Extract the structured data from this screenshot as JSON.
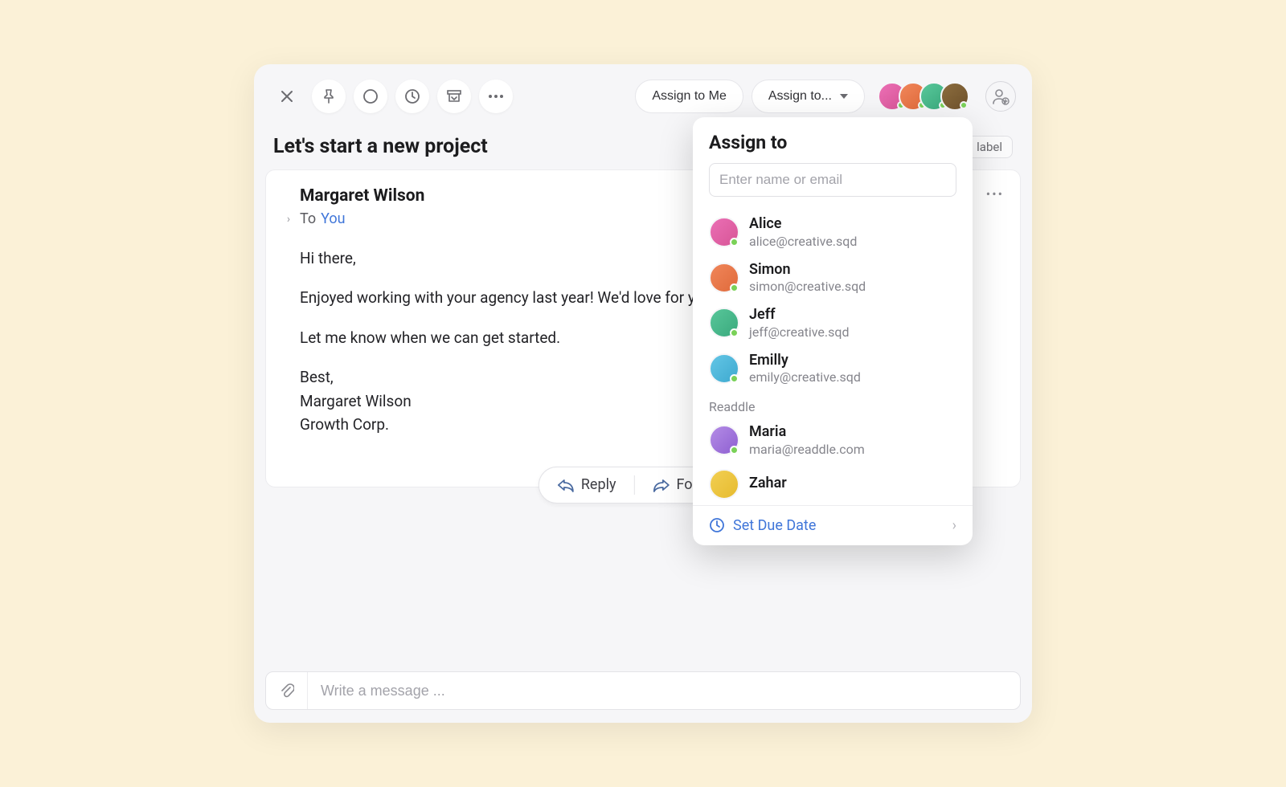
{
  "toolbar": {
    "assign_me": "Assign to Me",
    "assign_to": "Assign to..."
  },
  "subject": "Let's start a new project",
  "label_chip": "label",
  "message": {
    "sender": "Margaret Wilson",
    "to_label": "To",
    "to_value": "You",
    "body_line1": "Hi there,",
    "body_line2": "Enjoyed working with your agency last year! We'd love for you to design a new website for us.",
    "body_line3": "Let me know when we can get started.",
    "body_sig1": "Best,",
    "body_sig2": "Margaret Wilson",
    "body_sig3": "Growth Corp."
  },
  "actions": {
    "reply": "Reply",
    "forward": "Forward"
  },
  "composer": {
    "placeholder": "Write a message ..."
  },
  "popup": {
    "title": "Assign to",
    "input_placeholder": "Enter name or email",
    "people": [
      {
        "name": "Alice",
        "sub": "alice@creative.sqd",
        "color": "c1",
        "status": "green"
      },
      {
        "name": "Simon",
        "sub": "simon@creative.sqd",
        "color": "c2",
        "status": "green"
      },
      {
        "name": "Jeff",
        "sub": "jeff@creative.sqd",
        "color": "c3",
        "status": "green"
      },
      {
        "name": "Emilly",
        "sub": "emily@creative.sqd",
        "color": "c6",
        "status": "yellow"
      }
    ],
    "section": "Readdle",
    "people2": [
      {
        "name": "Maria",
        "sub": "maria@readdle.com",
        "color": "c5",
        "status": "green"
      },
      {
        "name": "Zahar",
        "sub": "",
        "color": "c7",
        "status": ""
      }
    ],
    "due": "Set Due Date"
  }
}
